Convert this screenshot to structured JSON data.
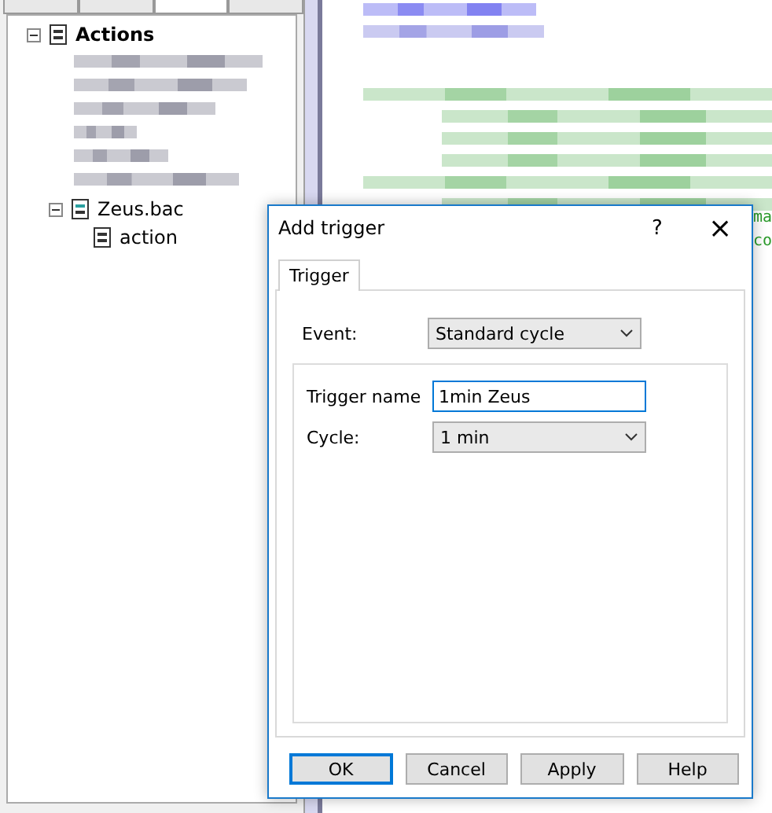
{
  "panel_tabs": [
    {
      "selected": false
    },
    {
      "selected": false
    },
    {
      "selected": true
    },
    {
      "selected": false
    }
  ],
  "tree": {
    "label": "Actions",
    "expanded": true,
    "children": [
      {
        "label": "Zeus.bac",
        "expanded": true,
        "children": [
          {
            "label": "action"
          }
        ]
      }
    ]
  },
  "editor_fragments": [
    {
      "text": "ma",
      "color": "#2a9a2a"
    },
    {
      "text": "co",
      "color": "#2a9a2a"
    }
  ],
  "dialog": {
    "title": "Add trigger",
    "help": "?",
    "close": "×",
    "tabs": [
      {
        "label": "Trigger",
        "selected": true
      }
    ],
    "event": {
      "label": "Event:",
      "value": "Standard cycle"
    },
    "trigger_name": {
      "label": "Trigger name",
      "value": "1min Zeus"
    },
    "cycle": {
      "label": "Cycle:",
      "value": "1 min"
    },
    "buttons": [
      {
        "label": "OK",
        "default": true
      },
      {
        "label": "Cancel",
        "default": false
      },
      {
        "label": "Apply",
        "default": false
      },
      {
        "label": "Help",
        "default": false
      }
    ]
  }
}
